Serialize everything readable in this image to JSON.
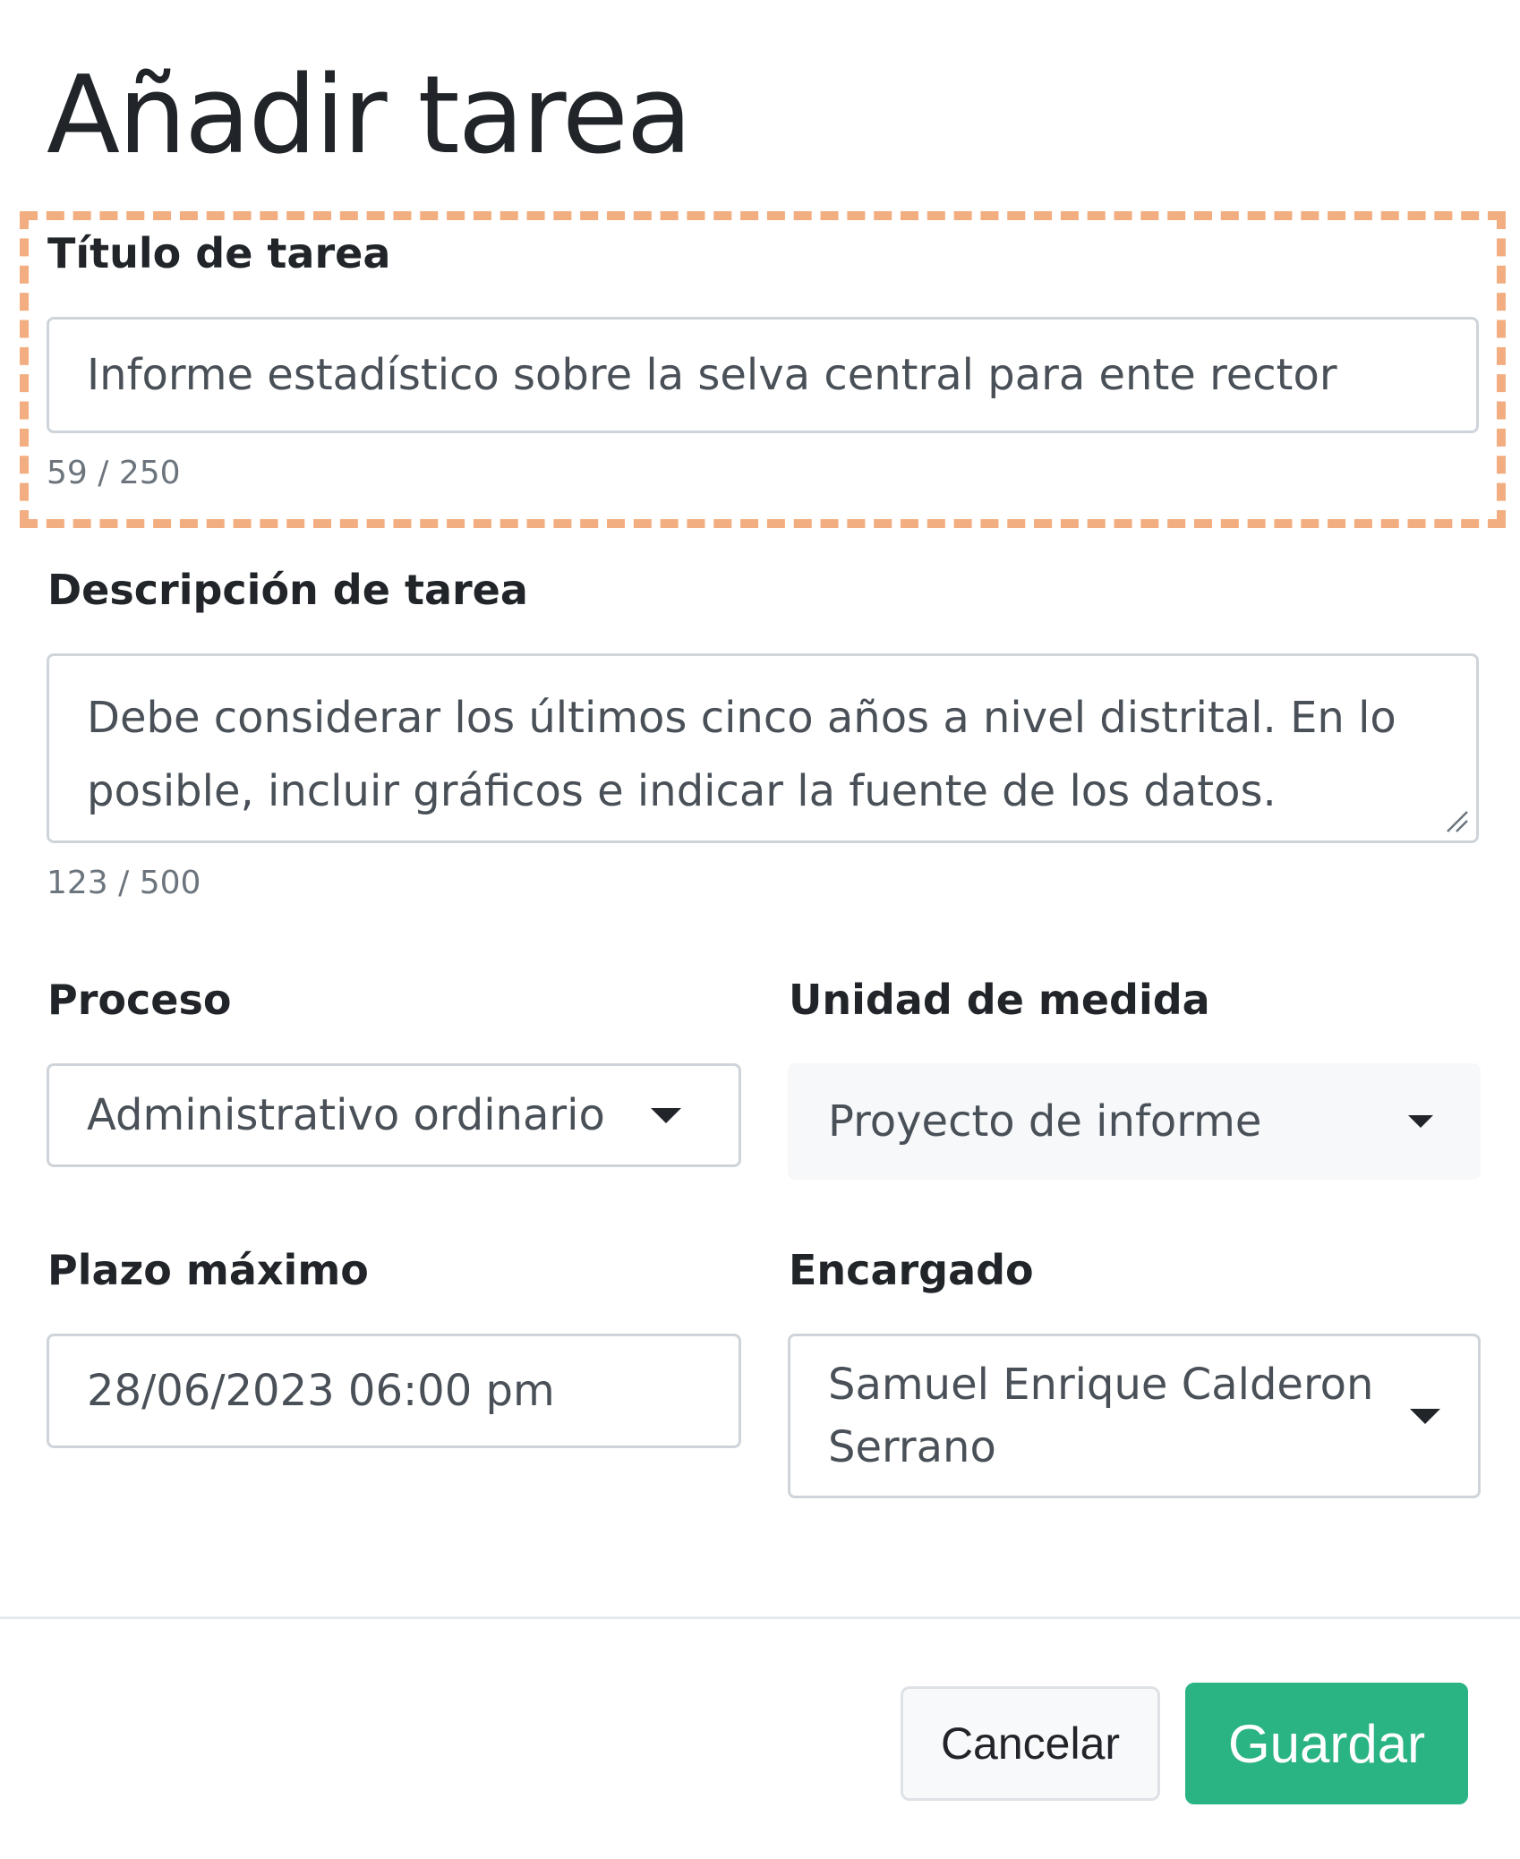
{
  "dialog": {
    "title": "Añadir tarea"
  },
  "form": {
    "task_title": {
      "label": "Título de tarea",
      "value": "Informe estadístico sobre la selva central para ente rector",
      "counter": "59 / 250"
    },
    "task_description": {
      "label": "Descripción de tarea",
      "value": "Debe considerar los últimos cinco años a nivel distrital. En lo posible, incluir gráficos e indicar la fuente de los datos.",
      "counter": "123 / 500"
    },
    "process": {
      "label": "Proceso",
      "selected": "Administrativo ordinario"
    },
    "unit": {
      "label": "Unidad de medida",
      "selected": "Proyecto de informe"
    },
    "deadline": {
      "label": "Plazo máximo",
      "value": "28/06/2023 06:00 pm"
    },
    "assignee": {
      "label": "Encargado",
      "selected": "Samuel Enrique Calderon Serrano"
    }
  },
  "footer": {
    "cancel_label": "Cancelar",
    "save_label": "Guardar"
  },
  "colors": {
    "highlight": "#f2ae80",
    "primary": "#2bb483"
  },
  "icons": {
    "dropdown": "caret-down-icon",
    "resize": "resize-grip-icon"
  }
}
